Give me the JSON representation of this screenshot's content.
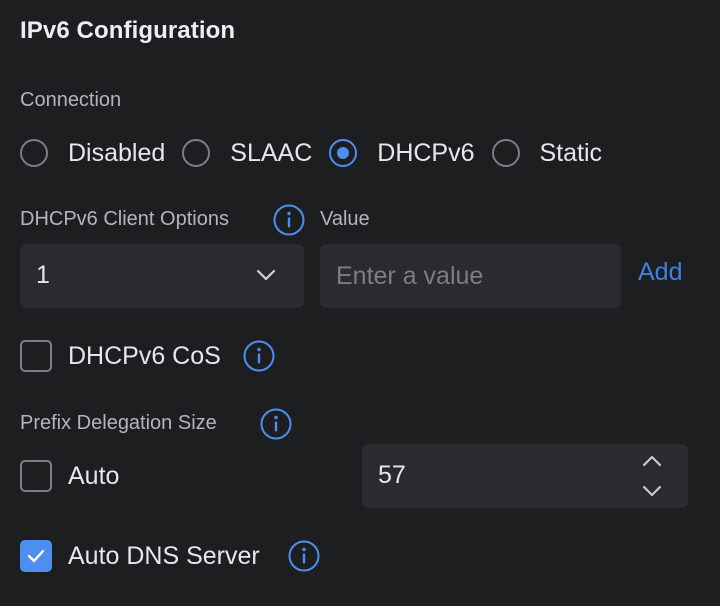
{
  "title": "IPv6 Configuration",
  "connection": {
    "label": "Connection",
    "options": [
      {
        "label": "Disabled",
        "checked": false
      },
      {
        "label": "SLAAC",
        "checked": false
      },
      {
        "label": "DHCPv6",
        "checked": true
      },
      {
        "label": "Static",
        "checked": false
      }
    ]
  },
  "client_options": {
    "label": "DHCPv6 Client Options",
    "value_label": "Value",
    "selected": "1",
    "value_placeholder": "Enter a value",
    "add_label": "Add"
  },
  "cos": {
    "label": "DHCPv6 CoS",
    "checked": false
  },
  "prefix": {
    "label": "Prefix Delegation Size",
    "auto_label": "Auto",
    "auto_checked": false,
    "value": "57"
  },
  "auto_dns": {
    "label": "Auto DNS Server",
    "checked": true
  },
  "colors": {
    "background": "#1d1e20",
    "field": "#2a2b2e",
    "accent": "#4d8ef0",
    "link": "#3f7fe8",
    "label": "#b2b5bb",
    "text": "#e6e7ea"
  },
  "icons": [
    "info-icon",
    "chevron-down-icon",
    "chevron-up-icon",
    "checkmark-icon"
  ]
}
